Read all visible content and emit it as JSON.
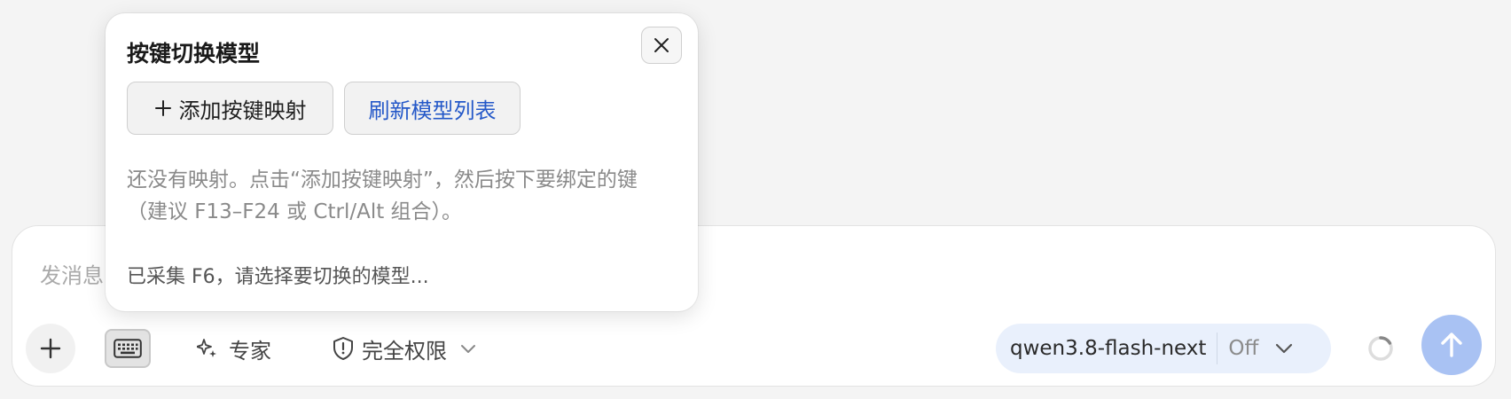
{
  "composer": {
    "placeholder": "发消息",
    "expert_label": "专家",
    "permission_label": "完全权限",
    "model_name": "qwen3.8-flash-next",
    "model_mode": "Off"
  },
  "popup": {
    "title": "按键切换模型",
    "add_button_label": "添加按键映射",
    "refresh_button_label": "刷新模型列表",
    "description": "还没有映射。点击“添加按键映射”，然后按下要绑定的键（建议 F13–F24 或 Ctrl/Alt 组合）。",
    "status": "已采集 F6，请选择要切换的模型..."
  },
  "colors": {
    "accent_link": "#2458c8",
    "model_pill_bg": "#e9f0fc",
    "send_button_bg": "#a9c2f3"
  },
  "icons": {
    "close": "close-icon",
    "add": "plus-icon",
    "attach": "plus-icon",
    "keyboard": "keyboard-icon",
    "expert": "sparkle-icon",
    "permission": "shield-icon",
    "dropdown": "chevron-down-icon",
    "loading": "spinner-icon",
    "send": "arrow-up-icon"
  }
}
